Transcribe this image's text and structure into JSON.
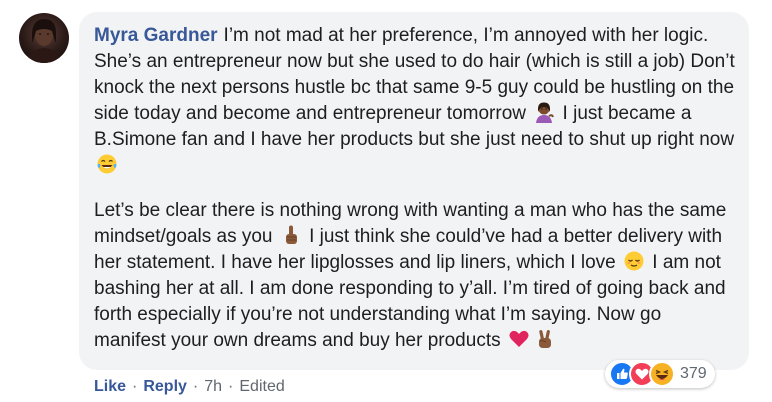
{
  "comment": {
    "author": "Myra Gardner",
    "paragraph1": {
      "part1": "I’m not mad at her preference, I’m annoyed with her logic. She’s an entrepreneur now but she used to do hair (which is still a job) Don’t knock the next persons hustle bc that same 9-5 guy could be hustling on the side today and become and entrepreneur tomorrow",
      "emoji1": "woman-tipping-hand-icon",
      "part2": "I just became a B.Simone fan and I have her products but she just need to shut up right now",
      "emoji2": "tears-of-joy-icon"
    },
    "paragraph2": {
      "part1": "Let’s be clear there is nothing wrong with wanting a man who has the same mindset/goals as you",
      "emoji1": "index-pointing-up-icon",
      "part2": "I just think she could’ve had a better delivery with her statement. I have her lipglosses and lip liners, which I love",
      "emoji2": "relieved-face-icon",
      "part3": "I am not bashing her at all. I am done responding to y’all. I’m tired of going back and forth especially if you’re not understanding what I’m saying. Now go manifest your own dreams and buy her products",
      "emoji3": "red-heart-icon",
      "emoji4": "victory-hand-icon"
    }
  },
  "actions": {
    "like": "Like",
    "reply": "Reply",
    "time": "7h",
    "edited": "Edited",
    "separator": "·"
  },
  "reactions": {
    "icons": [
      "like-reaction-icon",
      "love-reaction-icon",
      "haha-reaction-icon"
    ],
    "count": "379",
    "colors": {
      "like": "#1877f2",
      "love": "#f33e58",
      "haha": "#f7b125"
    }
  },
  "colors": {
    "link": "#385898",
    "bubble": "#f2f3f5",
    "meta": "#606770",
    "text": "#1c1e21"
  }
}
